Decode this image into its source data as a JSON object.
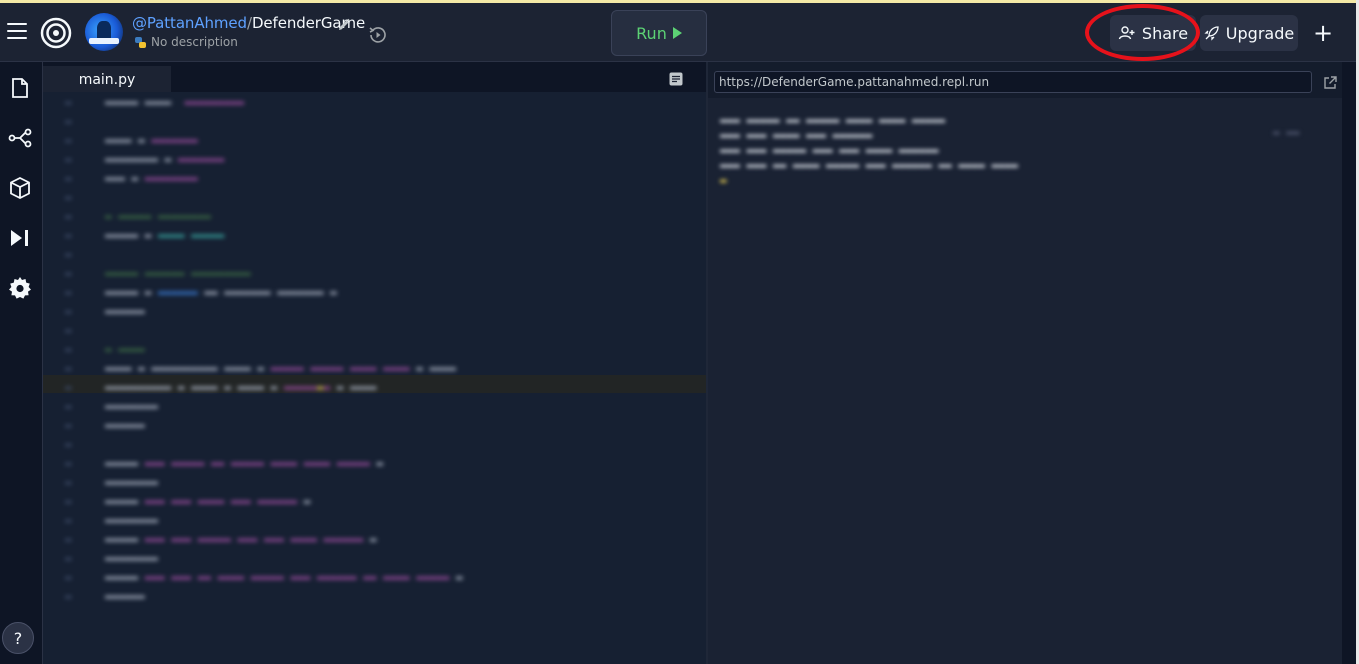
{
  "header": {
    "owner": "@PattanAhmed",
    "separator": "/",
    "repl_name": "DefenderGame",
    "description": "No description",
    "run_label": "Run",
    "share_label": "Share",
    "upgrade_label": "Upgrade",
    "new_label": "+"
  },
  "sidebar": {
    "help_label": "?"
  },
  "editor": {
    "tab_label": "main.py"
  },
  "webview": {
    "url": "https://DefenderGame.pattanahmed.repl.run"
  },
  "colors": {
    "background": "#0e1525",
    "header": "#1c2333",
    "run_green": "#5cd274",
    "link_blue": "#5ea1ff",
    "annotation_red": "#e6121b"
  }
}
